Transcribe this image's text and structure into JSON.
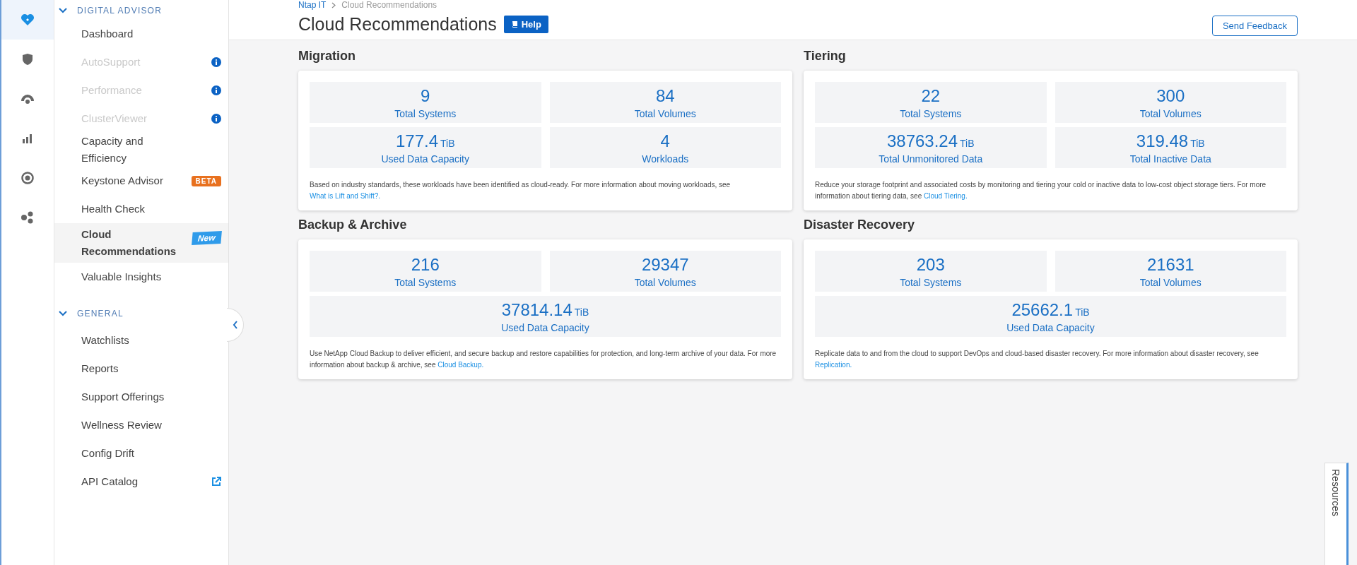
{
  "rail": [
    {
      "kind": "heart",
      "selected": true
    },
    {
      "kind": "shield",
      "selected": false
    },
    {
      "kind": "cloud",
      "selected": false
    },
    {
      "kind": "chart",
      "selected": false
    },
    {
      "kind": "target",
      "selected": false
    },
    {
      "kind": "nodes",
      "selected": false
    }
  ],
  "sidebar": {
    "sections": [
      {
        "title": "DIGITAL ADVISOR",
        "expanded": true,
        "items": [
          {
            "label": "Dashboard",
            "kind": "plain",
            "selected": false,
            "disabled": false
          },
          {
            "label": "AutoSupport",
            "kind": "info",
            "selected": false,
            "disabled": true
          },
          {
            "label": "Performance",
            "kind": "info",
            "selected": false,
            "disabled": true
          },
          {
            "label": "ClusterViewer",
            "kind": "info",
            "selected": false,
            "disabled": true
          },
          {
            "label": "Capacity and Efficiency",
            "kind": "plain",
            "selected": false,
            "disabled": false
          },
          {
            "label": "Keystone Advisor",
            "kind": "beta",
            "badge": "BETA",
            "selected": false,
            "disabled": false
          },
          {
            "label": "Health Check",
            "kind": "plain",
            "selected": false,
            "disabled": false
          },
          {
            "label": "Cloud Recommendations",
            "kind": "new",
            "badge": "New",
            "selected": true,
            "disabled": false
          },
          {
            "label": "Valuable Insights",
            "kind": "plain",
            "selected": false,
            "disabled": false
          }
        ]
      },
      {
        "title": "GENERAL",
        "expanded": true,
        "items": [
          {
            "label": "Watchlists",
            "kind": "plain",
            "selected": false,
            "disabled": false
          },
          {
            "label": "Reports",
            "kind": "plain",
            "selected": false,
            "disabled": false
          },
          {
            "label": "Support Offerings",
            "kind": "plain",
            "selected": false,
            "disabled": false
          },
          {
            "label": "Wellness Review",
            "kind": "plain",
            "selected": false,
            "disabled": false
          },
          {
            "label": "Config Drift",
            "kind": "plain",
            "selected": false,
            "disabled": false
          },
          {
            "label": "API Catalog",
            "kind": "external",
            "selected": false,
            "disabled": false
          }
        ]
      }
    ]
  },
  "breadcrumb": [
    "Ntap IT",
    "Cloud Recommendations"
  ],
  "page": {
    "title": "Cloud Recommendations",
    "help": "Help",
    "feedback": "Send Feedback"
  },
  "cards": [
    {
      "title": "Migration",
      "stats": [
        {
          "value": "9",
          "label": "Total Systems"
        },
        {
          "value": "84",
          "label": "Total Volumes"
        },
        {
          "value": "177.4",
          "unit": "TiB",
          "label": "Used Data Capacity"
        },
        {
          "value": "4",
          "label": "Workloads"
        }
      ],
      "description": "Based on industry standards, these workloads have been identified as cloud-ready. For more information about moving workloads, see",
      "link": "What is Lift and Shift?."
    },
    {
      "title": "Tiering",
      "stats": [
        {
          "value": "22",
          "label": "Total Systems"
        },
        {
          "value": "300",
          "label": "Total Volumes"
        },
        {
          "value": "38763.24",
          "unit": "TiB",
          "label": "Total Unmonitored Data"
        },
        {
          "value": "319.48",
          "unit": "TiB",
          "label": "Total Inactive Data"
        }
      ],
      "description": "Reduce your storage footprint and associated costs by monitoring and tiering your cold or inactive data to low-cost object storage tiers. For more information about tiering data, see",
      "link": "Cloud Tiering."
    },
    {
      "title": "Backup & Archive",
      "stats": [
        {
          "value": "216",
          "label": "Total Systems"
        },
        {
          "value": "29347",
          "label": "Total Volumes"
        },
        {
          "value": "37814.14",
          "unit": "TiB",
          "label": "Used Data Capacity"
        }
      ],
      "description": "Use NetApp Cloud Backup to deliver efficient, and secure backup and restore capabilities for protection, and long-term archive of your data. For more information about backup & archive, see",
      "link": "Cloud Backup."
    },
    {
      "title": "Disaster Recovery",
      "stats": [
        {
          "value": "203",
          "label": "Total Systems"
        },
        {
          "value": "21631",
          "label": "Total Volumes"
        },
        {
          "value": "25662.1",
          "unit": "TiB",
          "label": "Used Data Capacity"
        }
      ],
      "description": "Replicate data to and from the cloud to support DevOps and cloud-based disaster recovery. For more information about disaster recovery, see",
      "link": "Replication."
    }
  ],
  "resources_tab": "Resources"
}
